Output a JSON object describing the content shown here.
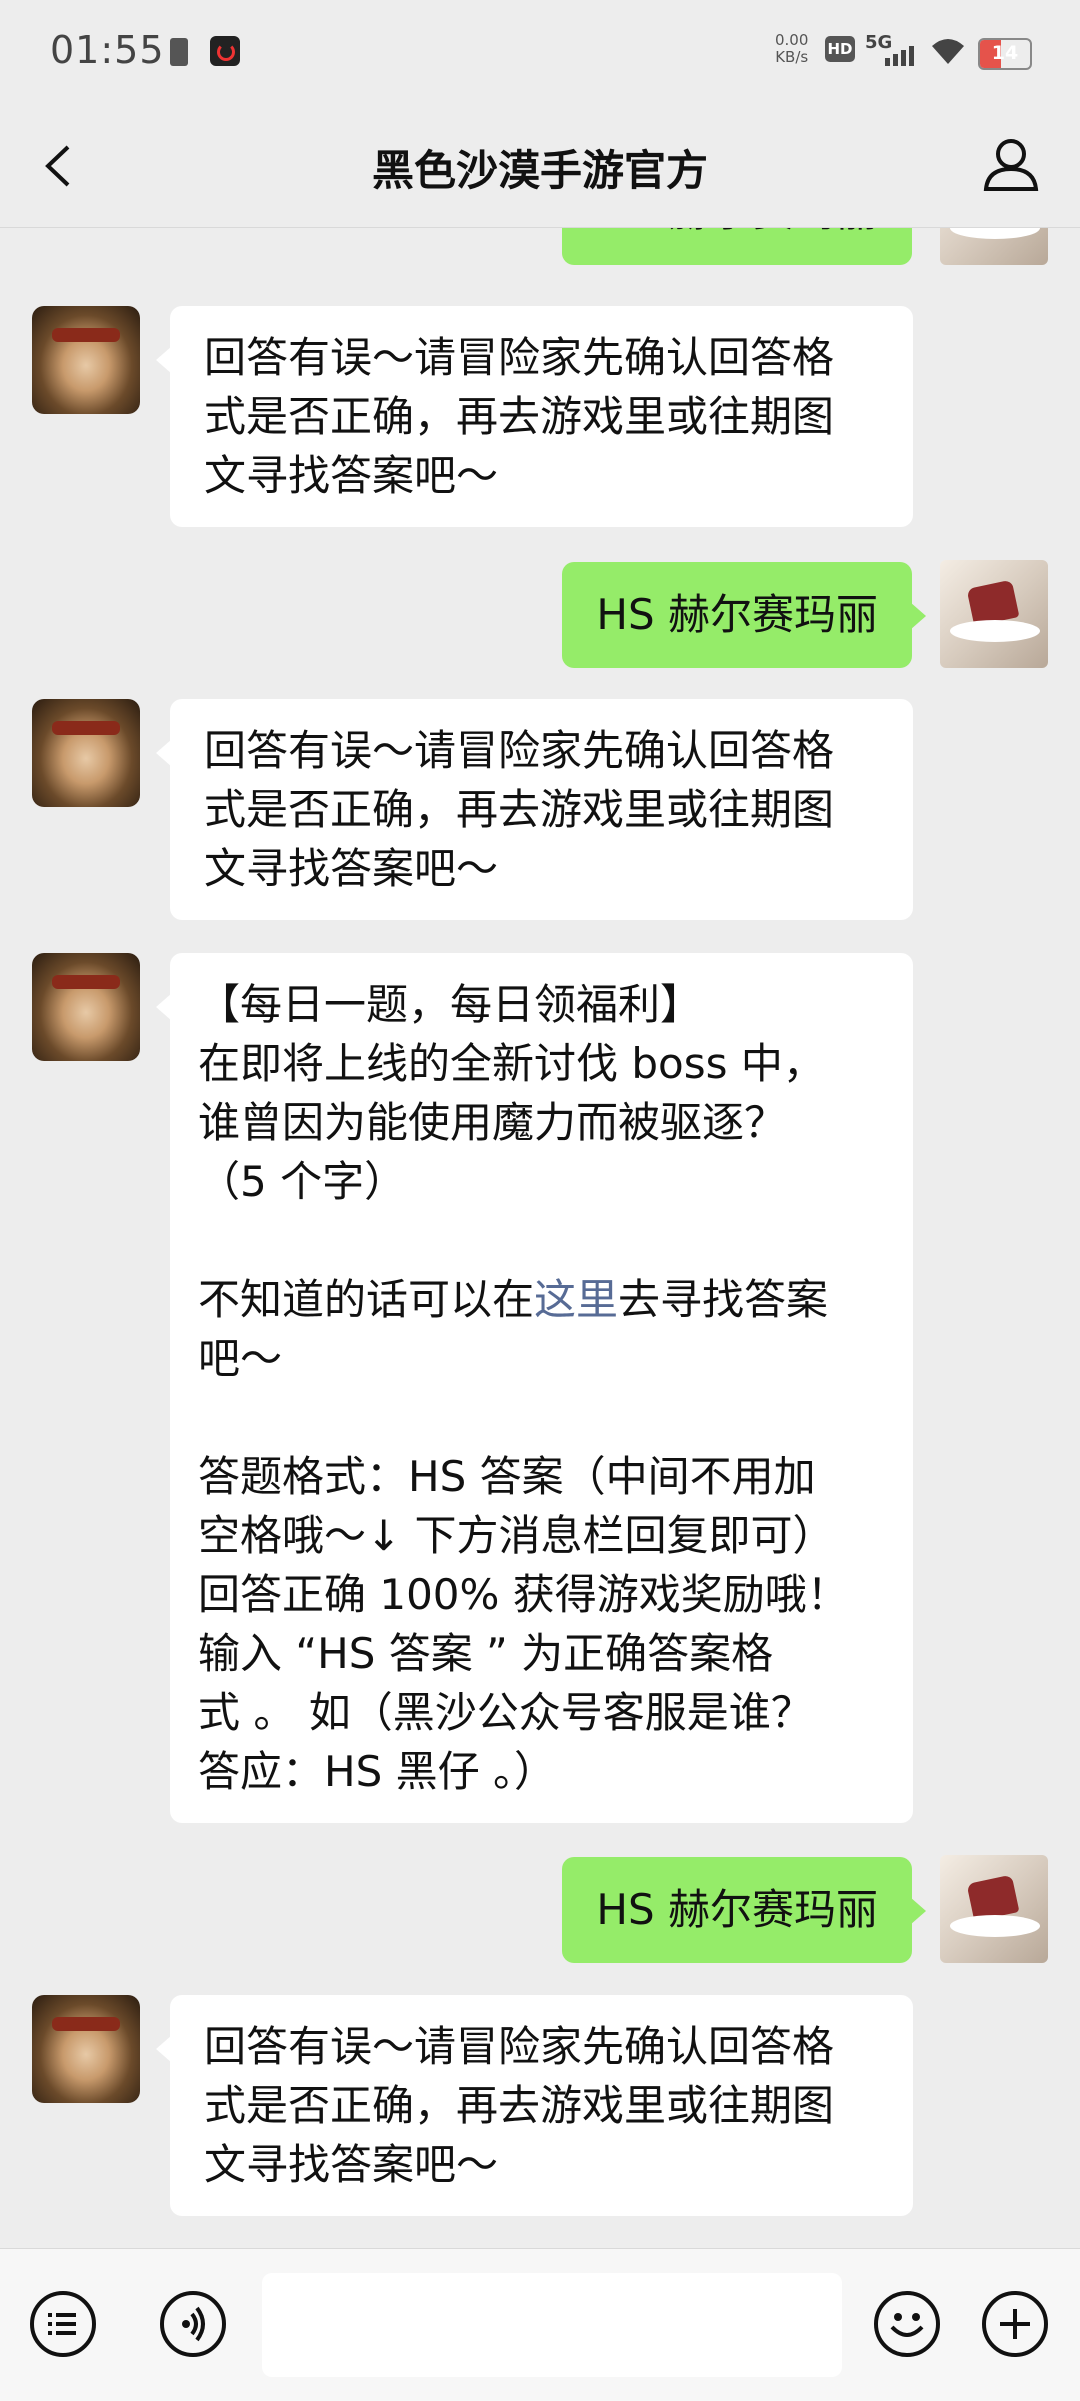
{
  "status_bar": {
    "time": "01:55",
    "net_speed_value": "0.00",
    "net_speed_unit": "KB/s",
    "hd": "HD",
    "network": "5G",
    "battery": "14",
    "battery_level": 0.14
  },
  "header": {
    "title": "黑色沙漠手游官方"
  },
  "messages": [
    {
      "side": "right",
      "text": "HS 赫尔赛玛丽"
    },
    {
      "side": "left",
      "text": "回答有误～请冒险家先确认回答格\n式是否正确，再去游戏里或往期图\n文寻找答案吧～"
    },
    {
      "side": "right",
      "text": "HS 赫尔赛玛丽"
    },
    {
      "side": "left",
      "text": "回答有误～请冒险家先确认回答格\n式是否正确，再去游戏里或往期图\n文寻找答案吧～"
    },
    {
      "side": "left",
      "part1": "【每日一题，每日领福利】\n在即将上线的全新讨伐 boss 中，\n谁曾因为能使用魔力而被驱逐？\n（5 个字）\n\n不知道的话可以在",
      "link": "这里",
      "part2": "去寻找答案\n吧～\n\n答题格式：HS 答案（中间不用加\n空格哦～↓ 下方消息栏回复即可）\n回答正确 100% 获得游戏奖励哦！\n输入 “HS 答案 ” 为正确答案格\n式 。 如（黑沙公众号客服是谁？\n答应：HS 黑仔 。）"
    },
    {
      "side": "right",
      "text": "HS 赫尔赛玛丽"
    },
    {
      "side": "left",
      "text": "回答有误～请冒险家先确认回答格\n式是否正确，再去游戏里或往期图\n文寻找答案吧～"
    }
  ]
}
